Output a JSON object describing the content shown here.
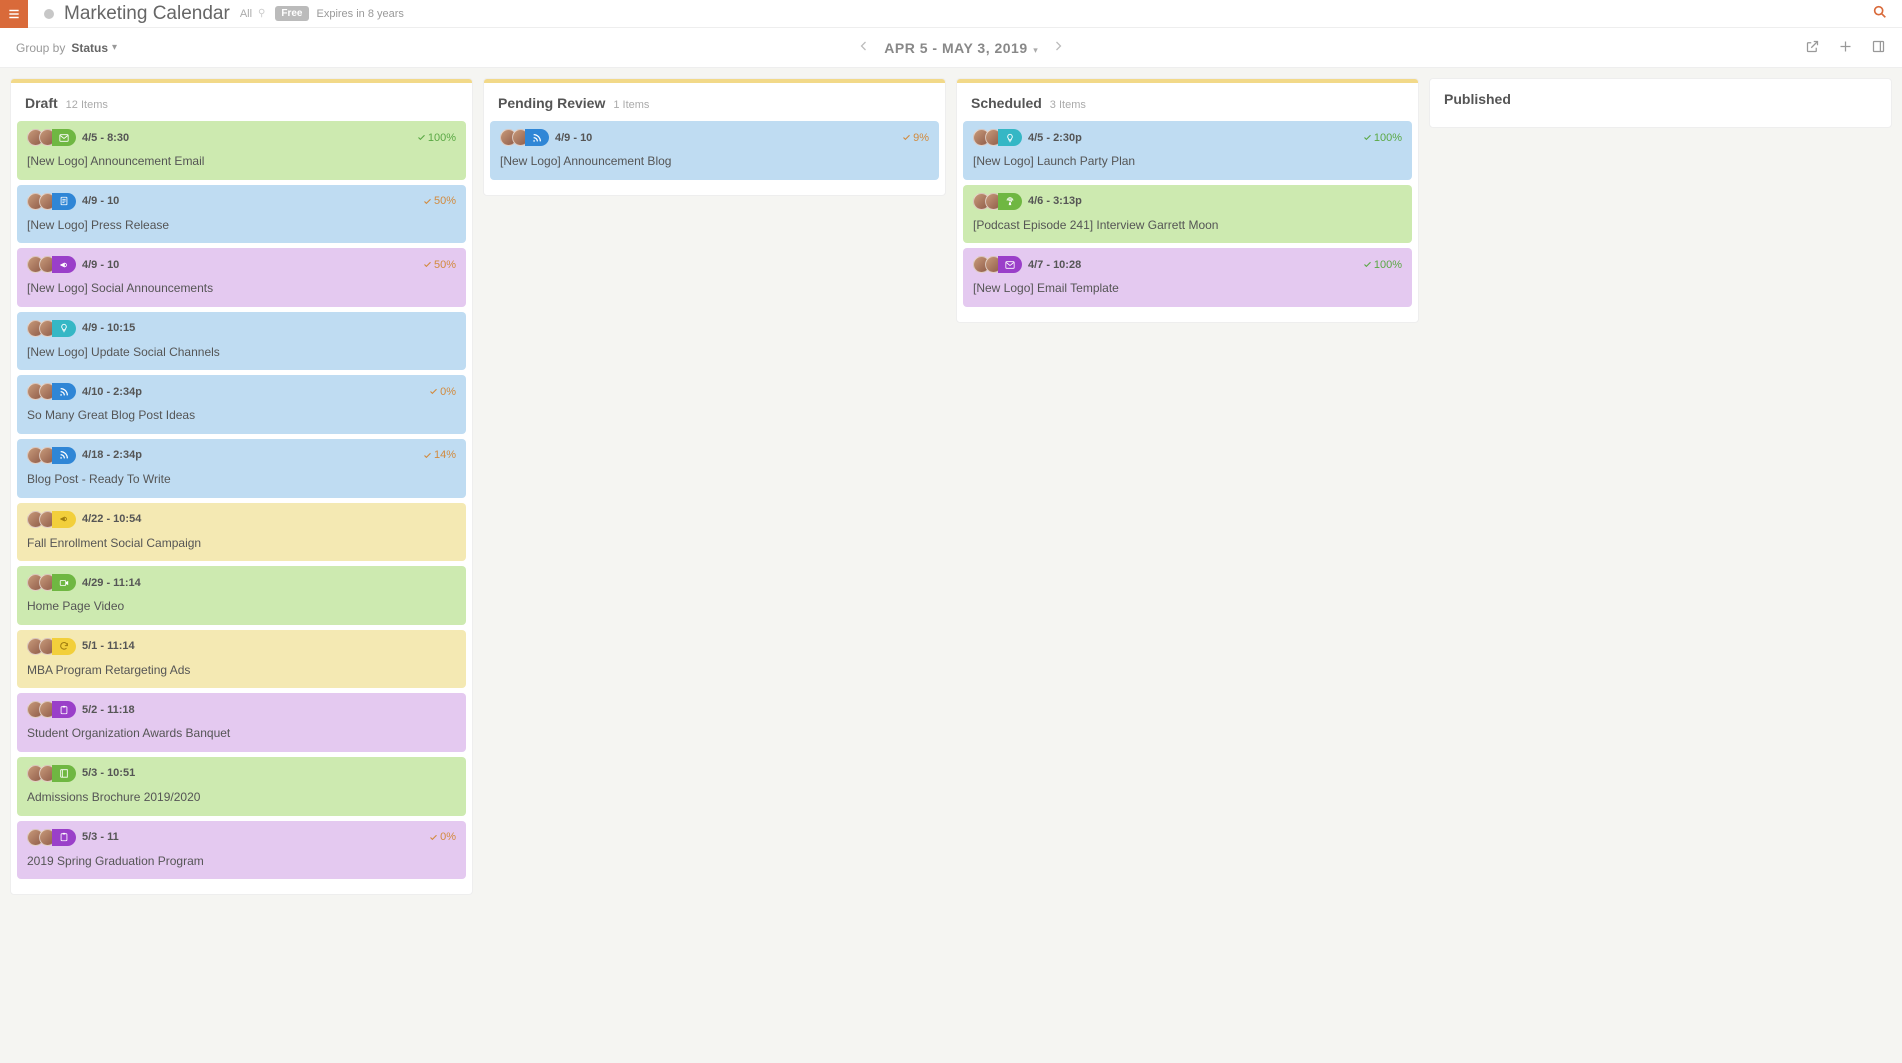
{
  "header": {
    "title": "Marketing Calendar",
    "filter": "All",
    "free_badge": "Free",
    "expires": "Expires in 8 years"
  },
  "controls": {
    "group_by_label": "Group by",
    "group_by_value": "Status",
    "date_range": "APR 5 - MAY 3, 2019"
  },
  "columns": [
    {
      "title": "Draft",
      "count": "12 Items",
      "accent": true,
      "cards": [
        {
          "color": "green",
          "pill": "green",
          "icon": "mail",
          "date": "4/5 - 8:30",
          "progress": "100%",
          "progColor": "green",
          "title": "[New Logo] Announcement Email"
        },
        {
          "color": "blue",
          "pill": "blue",
          "icon": "doc",
          "date": "4/9 - 10",
          "progress": "50%",
          "progColor": "orange",
          "title": "[New Logo] Press Release"
        },
        {
          "color": "purple",
          "pill": "purple",
          "icon": "horn",
          "date": "4/9 - 10",
          "progress": "50%",
          "progColor": "orange",
          "title": "[New Logo] Social Announcements"
        },
        {
          "color": "blue",
          "pill": "teal",
          "icon": "bulb",
          "date": "4/9 - 10:15",
          "progress": "",
          "progColor": "",
          "title": "[New Logo] Update Social Channels"
        },
        {
          "color": "blue",
          "pill": "blue",
          "icon": "rss",
          "date": "4/10 - 2:34p",
          "progress": "0%",
          "progColor": "orange",
          "title": "So Many Great Blog Post Ideas"
        },
        {
          "color": "blue",
          "pill": "blue",
          "icon": "rss",
          "date": "4/18 - 2:34p",
          "progress": "14%",
          "progColor": "orange",
          "title": "Blog Post - Ready To Write"
        },
        {
          "color": "yellow",
          "pill": "yellow",
          "icon": "horn",
          "date": "4/22 - 10:54",
          "progress": "",
          "progColor": "",
          "title": "Fall Enrollment Social Campaign"
        },
        {
          "color": "green",
          "pill": "green",
          "icon": "video",
          "date": "4/29 - 11:14",
          "progress": "",
          "progColor": "",
          "title": "Home Page Video"
        },
        {
          "color": "yellow",
          "pill": "yellow",
          "icon": "refresh",
          "date": "5/1 - 11:14",
          "progress": "",
          "progColor": "",
          "title": "MBA Program Retargeting Ads"
        },
        {
          "color": "purple",
          "pill": "purple",
          "icon": "clip",
          "date": "5/2 - 11:18",
          "progress": "",
          "progColor": "",
          "title": "Student Organization Awards Banquet"
        },
        {
          "color": "green",
          "pill": "green",
          "icon": "book",
          "date": "5/3 - 10:51",
          "progress": "",
          "progColor": "",
          "title": "Admissions Brochure 2019/2020"
        },
        {
          "color": "purple",
          "pill": "purple",
          "icon": "clip",
          "date": "5/3 - 11",
          "progress": "0%",
          "progColor": "orange",
          "title": "2019 Spring Graduation Program"
        }
      ]
    },
    {
      "title": "Pending Review",
      "count": "1 Items",
      "accent": true,
      "cards": [
        {
          "color": "blue",
          "pill": "blue",
          "icon": "rss",
          "date": "4/9 - 10",
          "progress": "9%",
          "progColor": "orange",
          "title": "[New Logo] Announcement Blog"
        }
      ]
    },
    {
      "title": "Scheduled",
      "count": "3 Items",
      "accent": true,
      "cards": [
        {
          "color": "blue",
          "pill": "teal",
          "icon": "bulb",
          "date": "4/5 - 2:30p",
          "progress": "100%",
          "progColor": "green",
          "title": "[New Logo] Launch Party Plan"
        },
        {
          "color": "green",
          "pill": "green",
          "icon": "podcast",
          "date": "4/6 - 3:13p",
          "progress": "",
          "progColor": "",
          "title": "[Podcast Episode 241] Interview Garrett Moon"
        },
        {
          "color": "purple",
          "pill": "purple",
          "icon": "mail",
          "date": "4/7 - 10:28",
          "progress": "100%",
          "progColor": "green",
          "title": "[New Logo] Email Template"
        }
      ]
    },
    {
      "title": "Published",
      "count": "",
      "accent": false,
      "cards": []
    }
  ]
}
